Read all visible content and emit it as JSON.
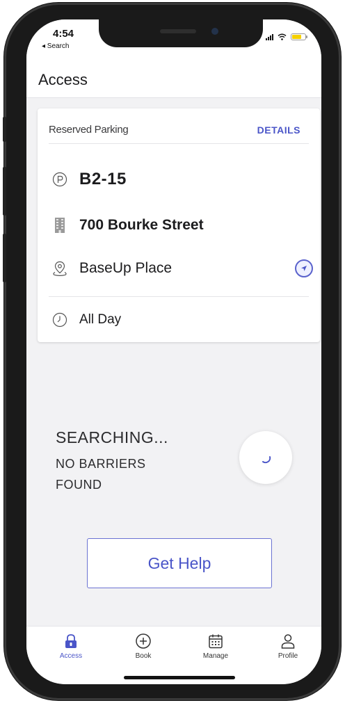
{
  "status_bar": {
    "time": "4:54",
    "back_label": "◂ Search"
  },
  "header": {
    "title": "Access"
  },
  "card": {
    "title": "Reserved Parking",
    "details_label": "DETAILS",
    "space": "B2-15",
    "building": "700 Bourke Street",
    "place": "BaseUp Place",
    "time": "All Day",
    "icons": [
      "parking-icon",
      "building-icon",
      "location-pin-icon",
      "navigate-icon",
      "clock-icon"
    ]
  },
  "search": {
    "title": "SEARCHING...",
    "subtitle": "NO BARRIERS FOUND"
  },
  "help_button": {
    "label": "Get Help"
  },
  "tabs": [
    {
      "label": "Access",
      "icon": "lock-icon",
      "active": true
    },
    {
      "label": "Book",
      "icon": "plus-circle-icon",
      "active": false
    },
    {
      "label": "Manage",
      "icon": "calendar-icon",
      "active": false
    },
    {
      "label": "Profile",
      "icon": "person-icon",
      "active": false
    }
  ],
  "colors": {
    "accent": "#4a55c8",
    "battery": "#f5d000",
    "background": "#f2f2f4"
  }
}
